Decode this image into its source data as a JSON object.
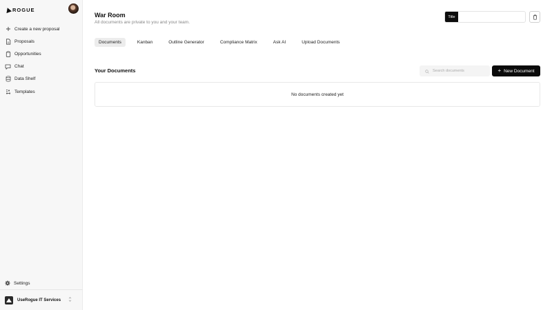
{
  "sidebar": {
    "logo_text": "ROGUE",
    "items": [
      {
        "label": "Create a new proposal",
        "icon": "plus-icon"
      },
      {
        "label": "Proposals",
        "icon": "file-icon"
      },
      {
        "label": "Opportunities",
        "icon": "clipboard-icon"
      },
      {
        "label": "Chat",
        "icon": "chat-icon"
      },
      {
        "label": "Data Shelf",
        "icon": "database-icon"
      },
      {
        "label": "Templates",
        "icon": "templates-icon"
      }
    ],
    "settings_label": "Settings",
    "org_name": "UseRogue IT Services"
  },
  "header": {
    "title": "War Room",
    "subtitle": "All documents are private to you and your team.",
    "title_field_label": "Title",
    "title_field_value": ""
  },
  "tabs": [
    {
      "label": "Documents",
      "active": true
    },
    {
      "label": "Kanban",
      "active": false
    },
    {
      "label": "Outline Generator",
      "active": false
    },
    {
      "label": "Compliance Matrix",
      "active": false
    },
    {
      "label": "Ask AI",
      "active": false
    },
    {
      "label": "Upload Documents",
      "active": false
    }
  ],
  "documents": {
    "section_title": "Your Documents",
    "search_placeholder": "Search documents",
    "new_button_label": "New Document",
    "empty_message": "No documents created yet"
  },
  "colors": {
    "primary": "#0b0b0b",
    "sidebar_bg": "#f7f7f7",
    "active_tab_bg": "#ececec"
  }
}
